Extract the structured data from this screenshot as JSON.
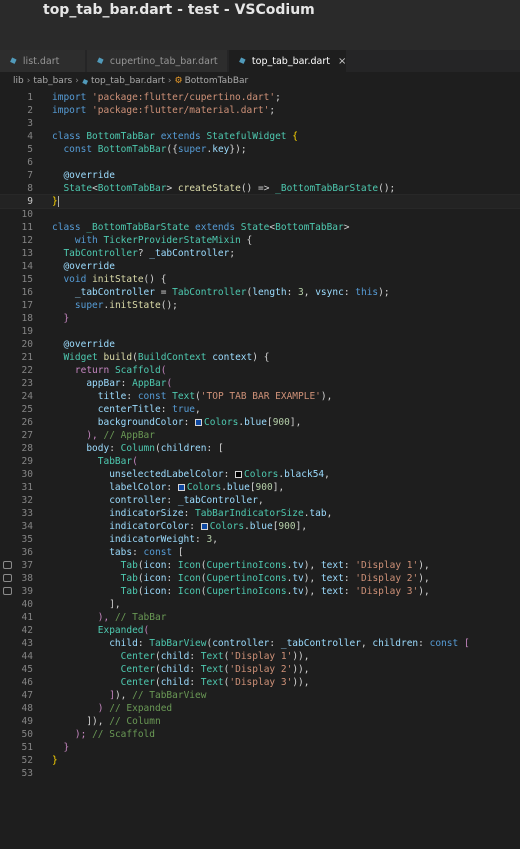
{
  "window": {
    "title": "top_tab_bar.dart - test - VSCodium"
  },
  "tabs": [
    {
      "label": "list.dart"
    },
    {
      "label": "cupertino_tab_bar.dart"
    },
    {
      "label": "top_tab_bar.dart",
      "close": "×"
    }
  ],
  "breadcrumb": {
    "parts": [
      "lib",
      "tab_bars",
      "top_tab_bar.dart",
      "BottomTabBar"
    ]
  },
  "colors": {
    "background": "#1e1e1e",
    "keyword": "#569cd6",
    "control": "#c586c0",
    "string": "#ce9178",
    "class": "#4ec9b0",
    "function": "#dcdcaa",
    "variable": "#9cdcfe",
    "number": "#b5cea8",
    "comment": "#6a9955",
    "swatch_blue900": "#0d47a1",
    "swatch_black54": "#000000"
  },
  "editor": {
    "current_line": 9,
    "lines": [
      [
        [
          "kw",
          "import "
        ],
        [
          "str",
          "'package:flutter/cupertino.dart'"
        ],
        [
          "pu",
          ";"
        ]
      ],
      [
        [
          "kw",
          "import "
        ],
        [
          "str",
          "'package:flutter/material.dart'"
        ],
        [
          "pu",
          ";"
        ]
      ],
      [],
      [
        [
          "kw",
          "class "
        ],
        [
          "cls",
          "BottomTabBar "
        ],
        [
          "kw",
          "extends "
        ],
        [
          "cls",
          "StatefulWidget "
        ],
        [
          "bk",
          "{"
        ]
      ],
      [
        [
          "pu",
          "  "
        ],
        [
          "kw",
          "const "
        ],
        [
          "cls",
          "BottomTabBar"
        ],
        [
          "pu",
          "({"
        ],
        [
          "kw",
          "super"
        ],
        [
          "pu",
          "."
        ],
        [
          "var",
          "key"
        ],
        [
          "pu",
          "});"
        ]
      ],
      [],
      [
        [
          "pu",
          "  "
        ],
        [
          "var",
          "@override"
        ]
      ],
      [
        [
          "pu",
          "  "
        ],
        [
          "cls",
          "State"
        ],
        [
          "pu",
          "<"
        ],
        [
          "cls",
          "BottomTabBar"
        ],
        [
          "pu",
          "> "
        ],
        [
          "fn",
          "createState"
        ],
        [
          "pu",
          "() => "
        ],
        [
          "cls",
          "_BottomTabBarState"
        ],
        [
          "pu",
          "();"
        ]
      ],
      [
        [
          "bk",
          "}"
        ]
      ],
      [],
      [
        [
          "kw",
          "class "
        ],
        [
          "cls",
          "_BottomTabBarState "
        ],
        [
          "kw",
          "extends "
        ],
        [
          "cls",
          "State"
        ],
        [
          "pu",
          "<"
        ],
        [
          "cls",
          "BottomTabBar"
        ],
        [
          "pu",
          ">"
        ]
      ],
      [
        [
          "pu",
          "    "
        ],
        [
          "kw",
          "with "
        ],
        [
          "cls",
          "TickerProviderStateMixin "
        ],
        [
          "pu",
          "{"
        ]
      ],
      [
        [
          "pu",
          "  "
        ],
        [
          "cls",
          "TabController"
        ],
        [
          "pu",
          "? "
        ],
        [
          "var",
          "_tabController"
        ],
        [
          "pu",
          ";"
        ]
      ],
      [
        [
          "pu",
          "  "
        ],
        [
          "var",
          "@override"
        ]
      ],
      [
        [
          "pu",
          "  "
        ],
        [
          "kw",
          "void "
        ],
        [
          "fn",
          "initState"
        ],
        [
          "pu",
          "() {"
        ]
      ],
      [
        [
          "pu",
          "    "
        ],
        [
          "var",
          "_tabController "
        ],
        [
          "pu",
          "= "
        ],
        [
          "cls",
          "TabController"
        ],
        [
          "pu",
          "("
        ],
        [
          "var",
          "length"
        ],
        [
          "pu",
          ": "
        ],
        [
          "num",
          "3"
        ],
        [
          "pu",
          ", "
        ],
        [
          "var",
          "vsync"
        ],
        [
          "pu",
          ": "
        ],
        [
          "kw",
          "this"
        ],
        [
          "pu",
          ");"
        ]
      ],
      [
        [
          "pu",
          "    "
        ],
        [
          "kw",
          "super"
        ],
        [
          "pu",
          "."
        ],
        [
          "fn",
          "initState"
        ],
        [
          "pu",
          "();"
        ]
      ],
      [
        [
          "pu",
          "  "
        ],
        [
          "ctl",
          "}"
        ]
      ],
      [],
      [
        [
          "pu",
          "  "
        ],
        [
          "var",
          "@override"
        ]
      ],
      [
        [
          "pu",
          "  "
        ],
        [
          "cls",
          "Widget "
        ],
        [
          "fn",
          "build"
        ],
        [
          "pu",
          "("
        ],
        [
          "cls",
          "BuildContext "
        ],
        [
          "var",
          "context"
        ],
        [
          "pu",
          ") {"
        ]
      ],
      [
        [
          "pu",
          "    "
        ],
        [
          "ctl",
          "return "
        ],
        [
          "cls",
          "Scaffold"
        ],
        [
          "ctl",
          "("
        ]
      ],
      [
        [
          "pu",
          "      "
        ],
        [
          "var",
          "appBar"
        ],
        [
          "pu",
          ": "
        ],
        [
          "cls",
          "AppBar"
        ],
        [
          "ctl",
          "("
        ]
      ],
      [
        [
          "pu",
          "        "
        ],
        [
          "var",
          "title"
        ],
        [
          "pu",
          ": "
        ],
        [
          "kw",
          "const "
        ],
        [
          "cls",
          "Text"
        ],
        [
          "pu",
          "("
        ],
        [
          "str",
          "'TOP TAB BAR EXAMPLE'"
        ],
        [
          "pu",
          "),"
        ]
      ],
      [
        [
          "pu",
          "        "
        ],
        [
          "var",
          "centerTitle"
        ],
        [
          "pu",
          ": "
        ],
        [
          "kw",
          "true"
        ],
        [
          "pu",
          ","
        ]
      ],
      [
        [
          "pu",
          "        "
        ],
        [
          "var",
          "backgroundColor"
        ],
        [
          "pu",
          ": "
        ],
        [
          "sw",
          "#0d47a1"
        ],
        [
          "cls",
          "Colors"
        ],
        [
          "pu",
          "."
        ],
        [
          "var",
          "blue"
        ],
        [
          "pu",
          "["
        ],
        [
          "num",
          "900"
        ],
        [
          "pu",
          "],"
        ]
      ],
      [
        [
          "pu",
          "      "
        ],
        [
          "ctl",
          "),"
        ],
        [
          "com",
          " // AppBar"
        ]
      ],
      [
        [
          "pu",
          "      "
        ],
        [
          "var",
          "body"
        ],
        [
          "pu",
          ": "
        ],
        [
          "cls",
          "Column"
        ],
        [
          "pu",
          "("
        ],
        [
          "var",
          "children"
        ],
        [
          "pu",
          ": ["
        ]
      ],
      [
        [
          "pu",
          "        "
        ],
        [
          "cls",
          "TabBar"
        ],
        [
          "ctl",
          "("
        ]
      ],
      [
        [
          "pu",
          "          "
        ],
        [
          "var",
          "unselectedLabelColor"
        ],
        [
          "pu",
          ": "
        ],
        [
          "sw",
          "#000000"
        ],
        [
          "cls",
          "Colors"
        ],
        [
          "pu",
          "."
        ],
        [
          "var",
          "black54"
        ],
        [
          "pu",
          ","
        ]
      ],
      [
        [
          "pu",
          "          "
        ],
        [
          "var",
          "labelColor"
        ],
        [
          "pu",
          ": "
        ],
        [
          "sw",
          "#0d47a1"
        ],
        [
          "cls",
          "Colors"
        ],
        [
          "pu",
          "."
        ],
        [
          "var",
          "blue"
        ],
        [
          "pu",
          "["
        ],
        [
          "num",
          "900"
        ],
        [
          "pu",
          "],"
        ]
      ],
      [
        [
          "pu",
          "          "
        ],
        [
          "var",
          "controller"
        ],
        [
          "pu",
          ": "
        ],
        [
          "var",
          "_tabController"
        ],
        [
          "pu",
          ","
        ]
      ],
      [
        [
          "pu",
          "          "
        ],
        [
          "var",
          "indicatorSize"
        ],
        [
          "pu",
          ": "
        ],
        [
          "cls",
          "TabBarIndicatorSize"
        ],
        [
          "pu",
          "."
        ],
        [
          "var",
          "tab"
        ],
        [
          "pu",
          ","
        ]
      ],
      [
        [
          "pu",
          "          "
        ],
        [
          "var",
          "indicatorColor"
        ],
        [
          "pu",
          ": "
        ],
        [
          "sw",
          "#0d47a1"
        ],
        [
          "cls",
          "Colors"
        ],
        [
          "pu",
          "."
        ],
        [
          "var",
          "blue"
        ],
        [
          "pu",
          "["
        ],
        [
          "num",
          "900"
        ],
        [
          "pu",
          "],"
        ]
      ],
      [
        [
          "pu",
          "          "
        ],
        [
          "var",
          "indicatorWeight"
        ],
        [
          "pu",
          ": "
        ],
        [
          "num",
          "3"
        ],
        [
          "pu",
          ","
        ]
      ],
      [
        [
          "pu",
          "          "
        ],
        [
          "var",
          "tabs"
        ],
        [
          "pu",
          ": "
        ],
        [
          "kw",
          "const "
        ],
        [
          "pu",
          "["
        ]
      ],
      [
        [
          "pu",
          "            "
        ],
        [
          "cls",
          "Tab"
        ],
        [
          "pu",
          "("
        ],
        [
          "var",
          "icon"
        ],
        [
          "pu",
          ": "
        ],
        [
          "cls",
          "Icon"
        ],
        [
          "pu",
          "("
        ],
        [
          "cls",
          "CupertinoIcons"
        ],
        [
          "pu",
          "."
        ],
        [
          "var",
          "tv"
        ],
        [
          "pu",
          "), "
        ],
        [
          "var",
          "text"
        ],
        [
          "pu",
          ": "
        ],
        [
          "str",
          "'Display 1'"
        ],
        [
          "pu",
          "),"
        ]
      ],
      [
        [
          "pu",
          "            "
        ],
        [
          "cls",
          "Tab"
        ],
        [
          "pu",
          "("
        ],
        [
          "var",
          "icon"
        ],
        [
          "pu",
          ": "
        ],
        [
          "cls",
          "Icon"
        ],
        [
          "pu",
          "("
        ],
        [
          "cls",
          "CupertinoIcons"
        ],
        [
          "pu",
          "."
        ],
        [
          "var",
          "tv"
        ],
        [
          "pu",
          "), "
        ],
        [
          "var",
          "text"
        ],
        [
          "pu",
          ": "
        ],
        [
          "str",
          "'Display 2'"
        ],
        [
          "pu",
          "),"
        ]
      ],
      [
        [
          "pu",
          "            "
        ],
        [
          "cls",
          "Tab"
        ],
        [
          "pu",
          "("
        ],
        [
          "var",
          "icon"
        ],
        [
          "pu",
          ": "
        ],
        [
          "cls",
          "Icon"
        ],
        [
          "pu",
          "("
        ],
        [
          "cls",
          "CupertinoIcons"
        ],
        [
          "pu",
          "."
        ],
        [
          "var",
          "tv"
        ],
        [
          "pu",
          "), "
        ],
        [
          "var",
          "text"
        ],
        [
          "pu",
          ": "
        ],
        [
          "str",
          "'Display 3'"
        ],
        [
          "pu",
          "),"
        ]
      ],
      [
        [
          "pu",
          "          "
        ],
        [
          "pu",
          "],"
        ]
      ],
      [
        [
          "pu",
          "        "
        ],
        [
          "ctl",
          "),"
        ],
        [
          "com",
          " // TabBar"
        ]
      ],
      [
        [
          "pu",
          "        "
        ],
        [
          "cls",
          "Expanded"
        ],
        [
          "ctl",
          "("
        ]
      ],
      [
        [
          "pu",
          "          "
        ],
        [
          "var",
          "child"
        ],
        [
          "pu",
          ": "
        ],
        [
          "cls",
          "TabBarView"
        ],
        [
          "pu",
          "("
        ],
        [
          "var",
          "controller"
        ],
        [
          "pu",
          ": "
        ],
        [
          "var",
          "_tabController"
        ],
        [
          "pu",
          ", "
        ],
        [
          "var",
          "children"
        ],
        [
          "pu",
          ": "
        ],
        [
          "kw",
          "const "
        ],
        [
          "ctl",
          "["
        ]
      ],
      [
        [
          "pu",
          "            "
        ],
        [
          "cls",
          "Center"
        ],
        [
          "pu",
          "("
        ],
        [
          "var",
          "child"
        ],
        [
          "pu",
          ": "
        ],
        [
          "cls",
          "Text"
        ],
        [
          "pu",
          "("
        ],
        [
          "str",
          "'Display 1'"
        ],
        [
          "pu",
          ")),"
        ]
      ],
      [
        [
          "pu",
          "            "
        ],
        [
          "cls",
          "Center"
        ],
        [
          "pu",
          "("
        ],
        [
          "var",
          "child"
        ],
        [
          "pu",
          ": "
        ],
        [
          "cls",
          "Text"
        ],
        [
          "pu",
          "("
        ],
        [
          "str",
          "'Display 2'"
        ],
        [
          "pu",
          ")),"
        ]
      ],
      [
        [
          "pu",
          "            "
        ],
        [
          "cls",
          "Center"
        ],
        [
          "pu",
          "("
        ],
        [
          "var",
          "child"
        ],
        [
          "pu",
          ": "
        ],
        [
          "cls",
          "Text"
        ],
        [
          "pu",
          "("
        ],
        [
          "str",
          "'Display 3'"
        ],
        [
          "pu",
          ")),"
        ]
      ],
      [
        [
          "pu",
          "          "
        ],
        [
          "ctl",
          "]"
        ],
        [
          "pu",
          "),"
        ],
        [
          "com",
          " // TabBarView"
        ]
      ],
      [
        [
          "pu",
          "        "
        ],
        [
          "ctl",
          ")"
        ],
        [
          "com",
          " // Expanded"
        ]
      ],
      [
        [
          "pu",
          "      "
        ],
        [
          "pu",
          "]),"
        ],
        [
          "com",
          " // Column"
        ]
      ],
      [
        [
          "pu",
          "    "
        ],
        [
          "ctl",
          ");"
        ],
        [
          "com",
          " // Scaffold"
        ]
      ],
      [
        [
          "pu",
          "  "
        ],
        [
          "ctl",
          "}"
        ]
      ],
      [
        [
          "bk",
          "}"
        ]
      ],
      []
    ],
    "comment_gutter_lines": [
      37,
      38,
      39
    ]
  }
}
